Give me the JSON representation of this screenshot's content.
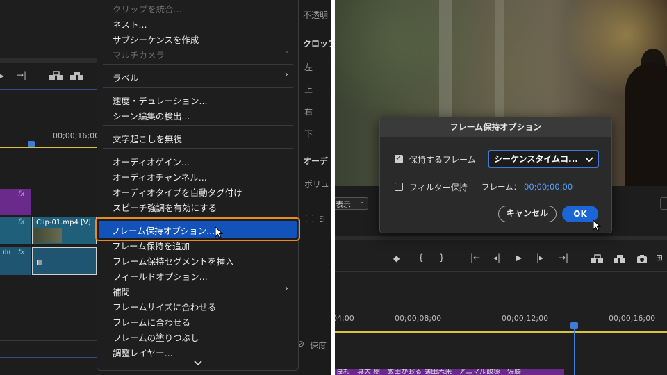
{
  "menu": {
    "items": [
      {
        "label": "クリップを統合...",
        "disabled": true
      },
      {
        "label": "ネスト..."
      },
      {
        "label": "サブシーケンスを作成"
      },
      {
        "label": "マルチカメラ",
        "disabled": true,
        "submenu": true
      },
      {
        "label": "ラベル",
        "submenu": true
      },
      {
        "label": "速度・デュレーション..."
      },
      {
        "label": "シーン編集の検出..."
      },
      {
        "label": "文字起こしを無視"
      },
      {
        "label": "オーディオゲイン..."
      },
      {
        "label": "オーディオチャンネル..."
      },
      {
        "label": "オーディオタイプを自動タグ付け"
      },
      {
        "label": "スピーチ強調を有効にする"
      },
      {
        "label": "フレーム保持オプション...",
        "highlighted": true
      },
      {
        "label": "フレーム保持を追加"
      },
      {
        "label": "フレーム保持セグメントを挿入"
      },
      {
        "label": "フィールドオプション..."
      },
      {
        "label": "補間",
        "submenu": true
      },
      {
        "label": "フレームサイズに合わせる"
      },
      {
        "label": "フレームに合わせる"
      },
      {
        "label": "フレームの塗りつぶし"
      },
      {
        "label": "調整レイヤー..."
      }
    ],
    "more_icon": "chevron-down-icon",
    "highlight_color": "#e88a22",
    "selection_color": "#1352b8"
  },
  "left_timeline": {
    "timecode": "00;00;16;00",
    "clip_label": "Clip-01.mp4 [V]",
    "fx_label": "fx"
  },
  "effect_controls": {
    "opacity": "不透明",
    "crop": "クロッフ",
    "left": "左",
    "top": "上",
    "right": "右",
    "bottom": "下",
    "audio": "オーデ",
    "volume": "ボリュ",
    "mi": "ミ",
    "speed": "速度"
  },
  "dialog": {
    "title": "フレーム保持オプション",
    "hold_frame_label": "保持するフレーム",
    "hold_frame_checked": true,
    "hold_frame_select": "シーケンスタイムコ...",
    "filter_hold_label": "フィルター保持",
    "filter_hold_checked": false,
    "frame_label": "フレーム：",
    "frame_value": "00;00;00;00",
    "cancel_label": "キャンセル",
    "ok_label": "OK"
  },
  "right_panel": {
    "display_label": "表示",
    "timecodes": [
      "04;00",
      "00;00;08;00",
      "00;00;12;00",
      "00;00;16;00"
    ],
    "caption_text": "良和　真大 樹　飯田かおる 諸田志来　アニマル飯塚　佐藤",
    "accent_color": "#1a66d6",
    "track_color": "#d8c33b"
  }
}
